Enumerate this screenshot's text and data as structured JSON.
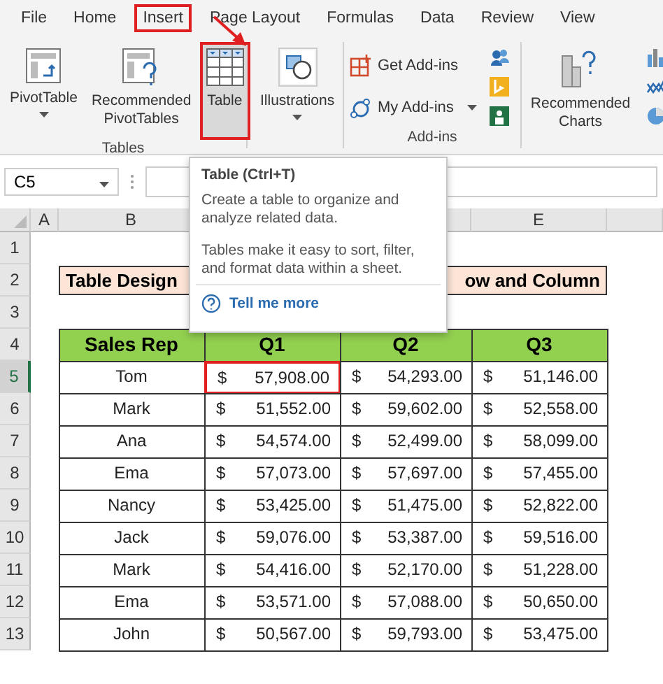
{
  "tabs": [
    {
      "label": "File",
      "selected": false
    },
    {
      "label": "Home",
      "selected": false
    },
    {
      "label": "Insert",
      "selected": true
    },
    {
      "label": "Page Layout",
      "selected": false
    },
    {
      "label": "Formulas",
      "selected": false
    },
    {
      "label": "Data",
      "selected": false
    },
    {
      "label": "Review",
      "selected": false
    },
    {
      "label": "View",
      "selected": false
    }
  ],
  "ribbon": {
    "groups": [
      {
        "label": "Tables",
        "buttons": [
          {
            "kind": "large",
            "label": "PivotTable",
            "dropdown": true,
            "highlighted": false
          },
          {
            "kind": "large",
            "label": "Recommended PivotTables",
            "dropdown": false,
            "highlighted": false
          },
          {
            "kind": "large",
            "label": "Table",
            "dropdown": false,
            "highlighted": true
          }
        ]
      },
      {
        "buttons": [
          {
            "kind": "large",
            "label": "Illustrations",
            "dropdown": true,
            "highlighted": false
          }
        ]
      },
      {
        "label": "Add-ins",
        "buttons": [
          {
            "kind": "small",
            "label": "Get Add-ins",
            "dropdown": false,
            "highlighted": false
          },
          {
            "kind": "small",
            "label": "My Add-ins",
            "dropdown": true,
            "highlighted": false
          },
          {
            "kind": "mini"
          },
          {
            "kind": "mini"
          },
          {
            "kind": "mini"
          }
        ]
      },
      {
        "buttons": [
          {
            "kind": "large",
            "label": "Recommended Charts",
            "dropdown": false,
            "highlighted": false
          },
          {
            "kind": "mini"
          },
          {
            "kind": "mini"
          },
          {
            "kind": "mini"
          }
        ]
      }
    ]
  },
  "formula_bar": {
    "name_box": "C5"
  },
  "tooltip": {
    "title": "Table (Ctrl+T)",
    "paragraphs": [
      "Create a table to organize and analyze related data.",
      "Tables make it easy to sort, filter, and format data within a sheet."
    ],
    "link": "Tell me more"
  },
  "sheet": {
    "column_headers": [
      {
        "label": "A"
      },
      {
        "label": "B"
      },
      {
        "label": "E"
      }
    ],
    "row_headers": [
      {
        "label": "1",
        "selected": false
      },
      {
        "label": "2",
        "selected": false
      },
      {
        "label": "3",
        "selected": false
      },
      {
        "label": "4",
        "selected": false
      },
      {
        "label": "5",
        "selected": true
      },
      {
        "label": "6",
        "selected": false
      },
      {
        "label": "7",
        "selected": false
      },
      {
        "label": "8",
        "selected": false
      },
      {
        "label": "9",
        "selected": false
      },
      {
        "label": "10",
        "selected": false
      },
      {
        "label": "11",
        "selected": false
      },
      {
        "label": "12",
        "selected": false
      },
      {
        "label": "13",
        "selected": false
      }
    ],
    "title": {
      "left": "Table Design",
      "right": "ow and Column"
    },
    "table": {
      "columns": [
        "Sales Rep",
        "Q1",
        "Q2",
        "Q3"
      ],
      "rows": [
        {
          "name": "Tom",
          "values": [
            {
              "currency": "$",
              "amount": "57,908.00",
              "highlighted": true
            },
            {
              "currency": "$",
              "amount": "54,293.00",
              "highlighted": false
            },
            {
              "currency": "$",
              "amount": "51,146.00",
              "highlighted": false
            }
          ]
        },
        {
          "name": "Mark",
          "values": [
            {
              "currency": "$",
              "amount": "51,552.00",
              "highlighted": false
            },
            {
              "currency": "$",
              "amount": "59,602.00",
              "highlighted": false
            },
            {
              "currency": "$",
              "amount": "52,558.00",
              "highlighted": false
            }
          ]
        },
        {
          "name": "Ana",
          "values": [
            {
              "currency": "$",
              "amount": "54,574.00",
              "highlighted": false
            },
            {
              "currency": "$",
              "amount": "52,499.00",
              "highlighted": false
            },
            {
              "currency": "$",
              "amount": "58,099.00",
              "highlighted": false
            }
          ]
        },
        {
          "name": "Ema",
          "values": [
            {
              "currency": "$",
              "amount": "57,073.00",
              "highlighted": false
            },
            {
              "currency": "$",
              "amount": "57,697.00",
              "highlighted": false
            },
            {
              "currency": "$",
              "amount": "57,455.00",
              "highlighted": false
            }
          ]
        },
        {
          "name": "Nancy",
          "values": [
            {
              "currency": "$",
              "amount": "53,425.00",
              "highlighted": false
            },
            {
              "currency": "$",
              "amount": "51,475.00",
              "highlighted": false
            },
            {
              "currency": "$",
              "amount": "52,822.00",
              "highlighted": false
            }
          ]
        },
        {
          "name": "Jack",
          "values": [
            {
              "currency": "$",
              "amount": "59,076.00",
              "highlighted": false
            },
            {
              "currency": "$",
              "amount": "53,387.00",
              "highlighted": false
            },
            {
              "currency": "$",
              "amount": "59,516.00",
              "highlighted": false
            }
          ]
        },
        {
          "name": "Mark",
          "values": [
            {
              "currency": "$",
              "amount": "54,416.00",
              "highlighted": false
            },
            {
              "currency": "$",
              "amount": "52,170.00",
              "highlighted": false
            },
            {
              "currency": "$",
              "amount": "51,228.00",
              "highlighted": false
            }
          ]
        },
        {
          "name": "Ema",
          "values": [
            {
              "currency": "$",
              "amount": "53,571.00",
              "highlighted": false
            },
            {
              "currency": "$",
              "amount": "57,088.00",
              "highlighted": false
            },
            {
              "currency": "$",
              "amount": "50,650.00",
              "highlighted": false
            }
          ]
        },
        {
          "name": "John",
          "values": [
            {
              "currency": "$",
              "amount": "50,567.00",
              "highlighted": false
            },
            {
              "currency": "$",
              "amount": "59,793.00",
              "highlighted": false
            },
            {
              "currency": "$",
              "amount": "53,475.00",
              "highlighted": false
            }
          ]
        }
      ]
    }
  }
}
